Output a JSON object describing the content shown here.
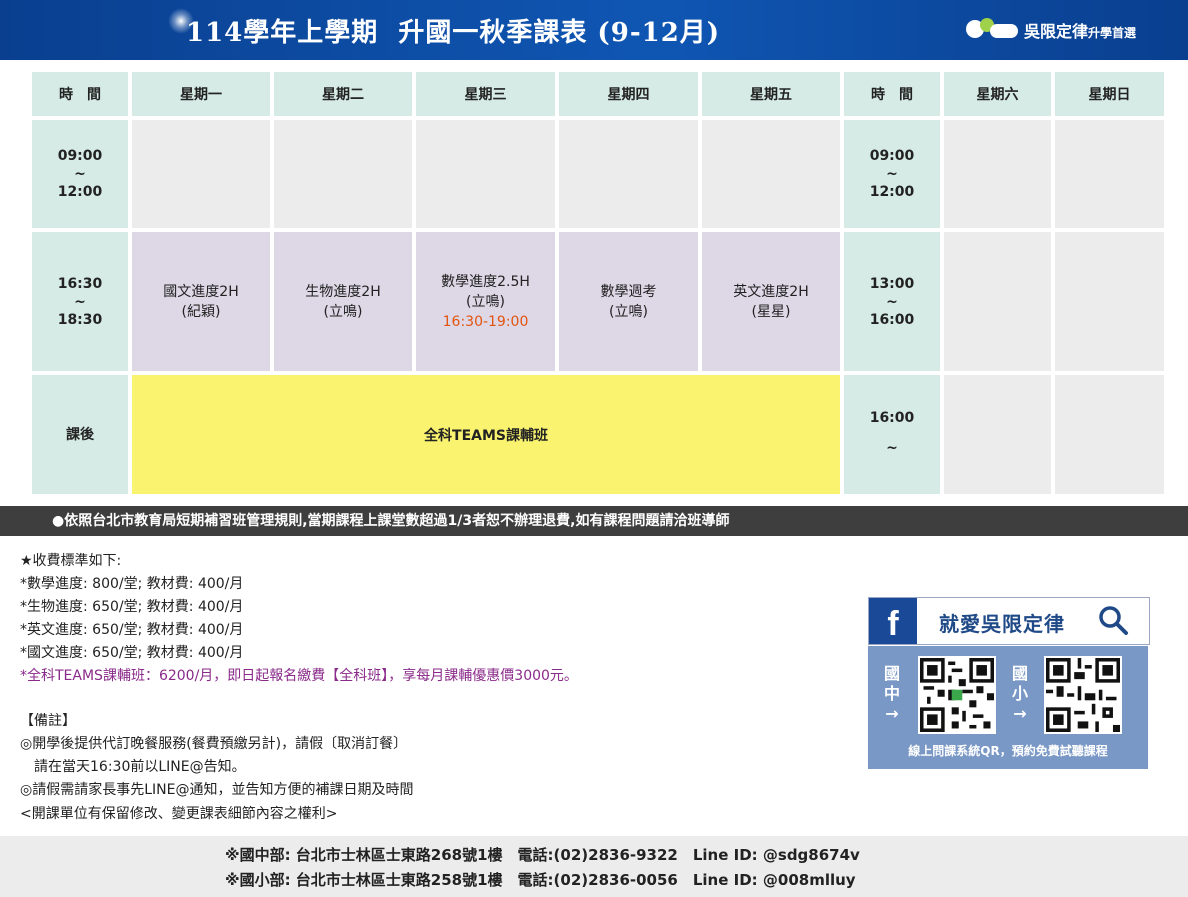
{
  "header": {
    "title": "114學年上學期  升國一秋季課表 (9-12月)",
    "logo_text": "吳限定律",
    "logo_sub": "升學首選"
  },
  "schedule": {
    "headers": [
      "時　間",
      "星期一",
      "星期二",
      "星期三",
      "星期四",
      "星期五",
      "時　間",
      "星期六",
      "星期日"
    ],
    "row1": {
      "time_start": "09:00",
      "time_sep": "~",
      "time_end": "12:00",
      "weekend_time_start": "09:00",
      "weekend_time_sep": "~",
      "weekend_time_end": "12:00"
    },
    "row2": {
      "time_start": "16:30",
      "time_sep": "~",
      "time_end": "18:30",
      "mon": {
        "course": "國文進度2H",
        "teacher": "(紀穎)"
      },
      "tue": {
        "course": "生物進度2H",
        "teacher": "(立鳴)"
      },
      "wed": {
        "course": "數學進度2.5H",
        "teacher": "(立鳴)",
        "time": "16:30-19:00"
      },
      "thu": {
        "course": "數學週考",
        "teacher": "(立鳴)"
      },
      "fri": {
        "course": "英文進度2H",
        "teacher": "(星星)"
      },
      "weekend_time_start": "13:00",
      "weekend_time_sep": "~",
      "weekend_time_end": "16:00"
    },
    "row3": {
      "label": "課後",
      "course": "全科TEAMS課輔班",
      "weekend_time_start": "16:00",
      "weekend_time_sep": "~"
    }
  },
  "notice": "●依照台北市教育局短期補習班管理規則,當期課程上課堂數超過1/3者恕不辦理退費,如有課程問題請洽班導師",
  "fees": {
    "title": "★收費標準如下:",
    "items": [
      "*數學進度: 800/堂; 教材費: 400/月",
      "*生物進度: 650/堂; 教材費: 400/月",
      "*英文進度: 650/堂; 教材費: 400/月",
      "*國文進度: 650/堂; 教材費: 400/月"
    ],
    "highlight": "*全科TEAMS課輔班：6200/月，即日起報名繳費【全科班】，享每月課輔優惠價3000元。"
  },
  "remarks": {
    "title": "【備註】",
    "items": [
      "◎開學後提供代訂晚餐服務(餐費預繳另計)，請假〔取消訂餐〕",
      "　請在當天16:30前以LINE@告知。",
      "◎請假需請家長事先LINE@通知，並告知方便的補課日期及時間"
    ],
    "footnote": "<開課單位有保留修改、變更課表細節內容之權利>"
  },
  "facebook": {
    "text": "就愛吳限定律",
    "icon": "facebook-icon"
  },
  "qr": {
    "label_junior": "國中→",
    "label_elem": "國小→",
    "caption": "線上問課系統QR，預約免費試聽課程"
  },
  "footer": {
    "line1": "※國中部: 台北市士林區士東路268號1樓　電話:(02)2836-9322　Line ID: @sdg8674v",
    "line2": "※國小部: 台北市士林區士東路258號1樓　電話:(02)2836-0056　Line ID: @008mlluy"
  },
  "colors": {
    "header_blue": "#0f56b3",
    "header_cell": "#d6ebe5",
    "course_cell": "#ddd7e6",
    "teams_cell": "#f9f36f",
    "empty_cell": "#ececec",
    "notice_bar": "#3e3e3e",
    "highlight_orange": "#e3540f",
    "highlight_purple": "#8a2a8a",
    "qr_panel": "#7a98c5"
  }
}
